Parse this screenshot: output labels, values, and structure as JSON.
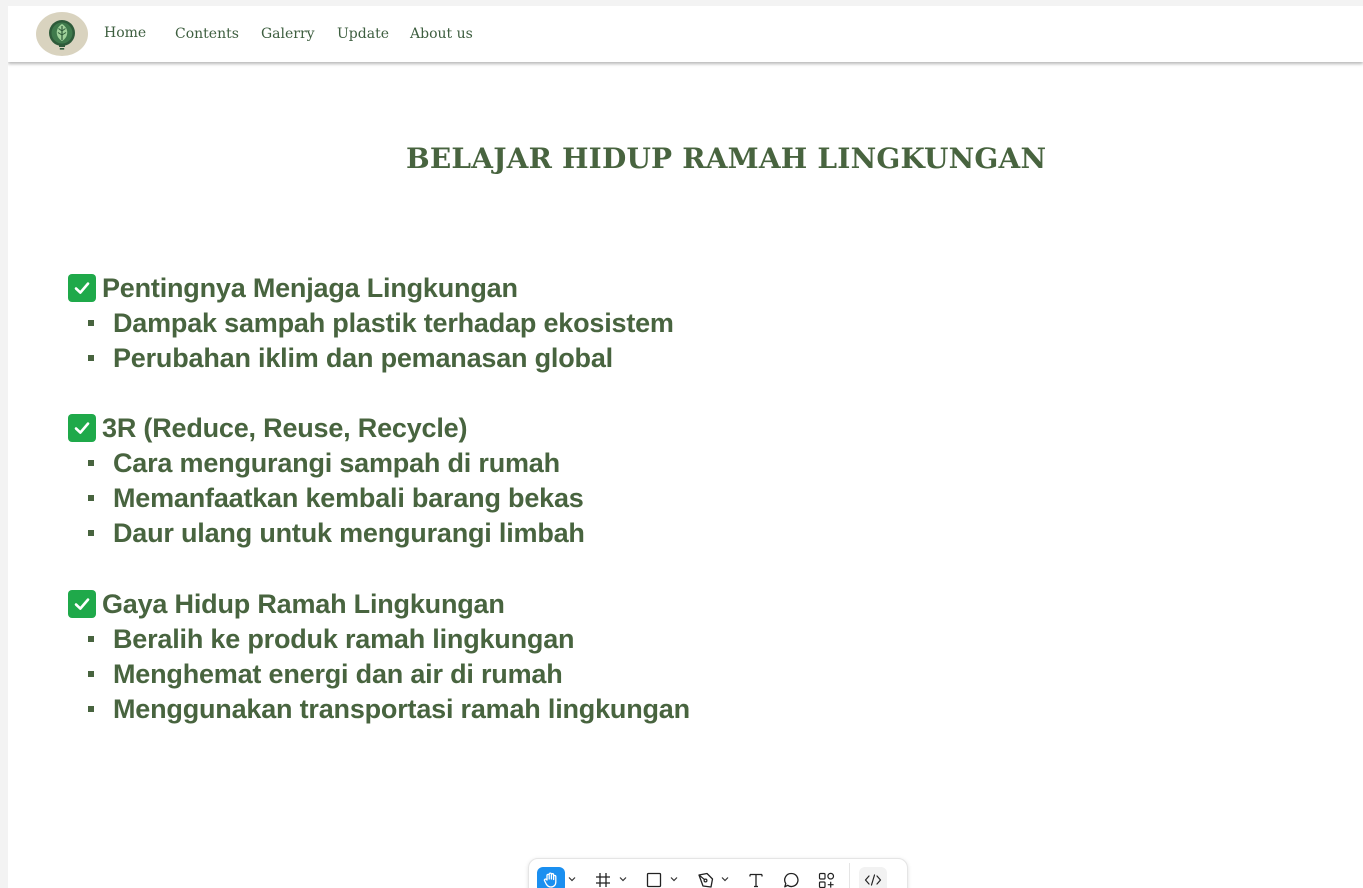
{
  "nav": {
    "items": [
      {
        "label": "Home"
      },
      {
        "label": "Contents"
      },
      {
        "label": "Galerry"
      },
      {
        "label": "Update"
      },
      {
        "label": "About us"
      }
    ]
  },
  "page": {
    "title": "BELAJAR HIDUP RAMAH LINGKUNGAN"
  },
  "sections": [
    {
      "title": "Pentingnya Menjaga Lingkungan",
      "icon": "check-box-icon",
      "items": [
        "Dampak sampah plastik terhadap ekosistem",
        "Perubahan iklim dan pemanasan global"
      ]
    },
    {
      "title": "3R (Reduce, Reuse, Recycle)",
      "icon": "check-box-icon",
      "items": [
        "Cara mengurangi sampah di rumah",
        "Memanfaatkan kembali barang bekas",
        "Daur ulang untuk mengurangi limbah"
      ]
    },
    {
      "title": "Gaya Hidup Ramah Lingkungan",
      "icon": "check-box-icon",
      "items": [
        "Beralih ke produk ramah lingkungan",
        "Menghemat energi dan air di rumah",
        "Menggunakan transportasi ramah lingkungan"
      ]
    }
  ],
  "toolbar": {
    "tools": [
      "hand-icon",
      "frame-icon",
      "rectangle-icon",
      "pen-icon",
      "text-icon",
      "comment-icon",
      "components-icon",
      "code-icon"
    ],
    "active_tool": "hand-icon"
  },
  "colors": {
    "text_green": "#48643f",
    "nav_green": "#3d5e3f",
    "check_green": "#1fa94a",
    "logo_bg": "#d9d3bf",
    "toolbar_active": "#1a8ff0"
  }
}
